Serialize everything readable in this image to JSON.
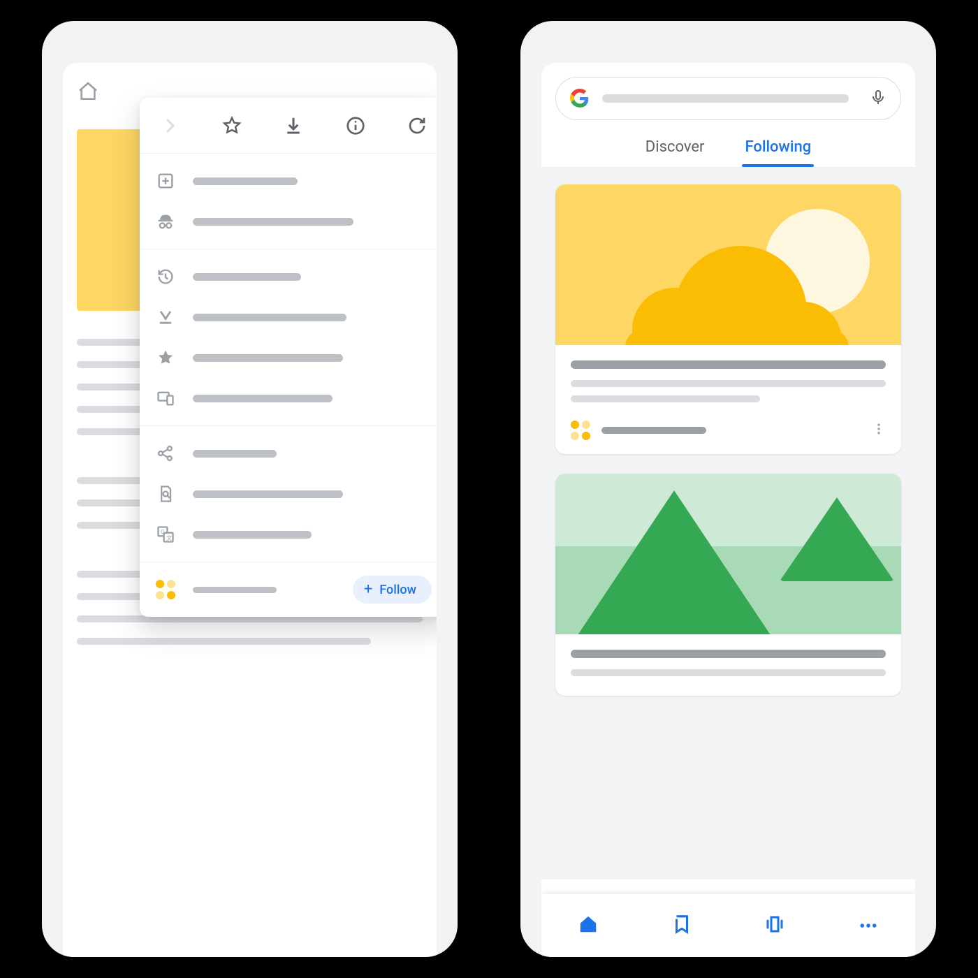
{
  "colors": {
    "accent": "#1a73e8",
    "warn": "#fbbc04",
    "warnLight": "#fdd663",
    "green": "#34a853"
  },
  "left": {
    "toolbar": {
      "icons": [
        "forward-icon",
        "star-icon",
        "download-icon",
        "info-icon",
        "reload-icon"
      ]
    },
    "menu_sections": [
      {
        "rows": [
          {
            "icon": "new-tab-icon",
            "len": 150
          },
          {
            "icon": "incognito-icon",
            "len": 230
          }
        ]
      },
      {
        "rows": [
          {
            "icon": "history-icon",
            "len": 155
          },
          {
            "icon": "downloads-icon",
            "len": 220
          },
          {
            "icon": "bookmarks-icon",
            "len": 215
          },
          {
            "icon": "recent-tabs-icon",
            "len": 200
          }
        ]
      },
      {
        "rows": [
          {
            "icon": "share-icon",
            "len": 120
          },
          {
            "icon": "find-in-page-icon",
            "len": 215
          },
          {
            "icon": "translate-icon",
            "len": 170
          }
        ]
      }
    ],
    "follow": {
      "label": "Follow"
    }
  },
  "right": {
    "tabs": {
      "discover": "Discover",
      "following": "Following",
      "active": "following"
    },
    "bottom_nav": [
      "home-icon",
      "bookmarks-icon",
      "carousel-icon",
      "more-icon"
    ]
  }
}
